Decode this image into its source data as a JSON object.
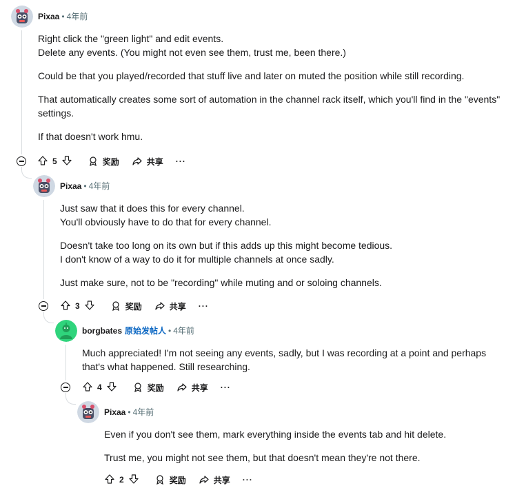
{
  "comments": [
    {
      "author": "Pixaa",
      "op_badge": "",
      "time": "4年前",
      "paragraphs": [
        [
          "Right click the \"green light\" and edit events.",
          "Delete any events. (You might not even see them, trust me, been there.)"
        ],
        [
          "Could be that you played/recorded that stuff live and later on muted the position while still recording."
        ],
        [
          "That automatically creates some sort of automation in the channel rack itself, which you'll find in the \"events\"",
          "settings."
        ],
        [
          "If that doesn't work hmu."
        ]
      ],
      "votes": "5",
      "award_label": "奖励",
      "share_label": "共享",
      "more_label": "···"
    },
    {
      "author": "Pixaa",
      "op_badge": "",
      "time": "4年前",
      "paragraphs": [
        [
          "Just saw that it does this for every channel.",
          "You'll obviously have to do that for every channel."
        ],
        [
          "Doesn't take too long on its own but if this adds up this might become tedious.",
          "I don't know of a way to do it for multiple channels at once sadly."
        ],
        [
          "Just make sure, not to be \"recording\" while muting and or soloing channels."
        ]
      ],
      "votes": "3",
      "award_label": "奖励",
      "share_label": "共享",
      "more_label": "···"
    },
    {
      "author": "borgbates",
      "op_badge": "原始发帖人",
      "time": "4年前",
      "paragraphs": [
        [
          "Much appreciated! I'm not seeing any events, sadly, but I was recording at a point and perhaps",
          "that's what happened. Still researching."
        ]
      ],
      "votes": "4",
      "award_label": "奖励",
      "share_label": "共享",
      "more_label": "···"
    },
    {
      "author": "Pixaa",
      "op_badge": "",
      "time": "4年前",
      "paragraphs": [
        [
          "Even if you don't see them, mark everything inside the events tab and hit delete."
        ],
        [
          "Trust me, you might not see them, but that doesn't mean they're not there."
        ]
      ],
      "votes": "2",
      "award_label": "奖励",
      "share_label": "共享",
      "more_label": "···"
    }
  ],
  "dot_separator": "•",
  "colors": {
    "op_badge": "#0a66c2",
    "thread_line": "#d9dde0",
    "meta": "#576f76"
  }
}
